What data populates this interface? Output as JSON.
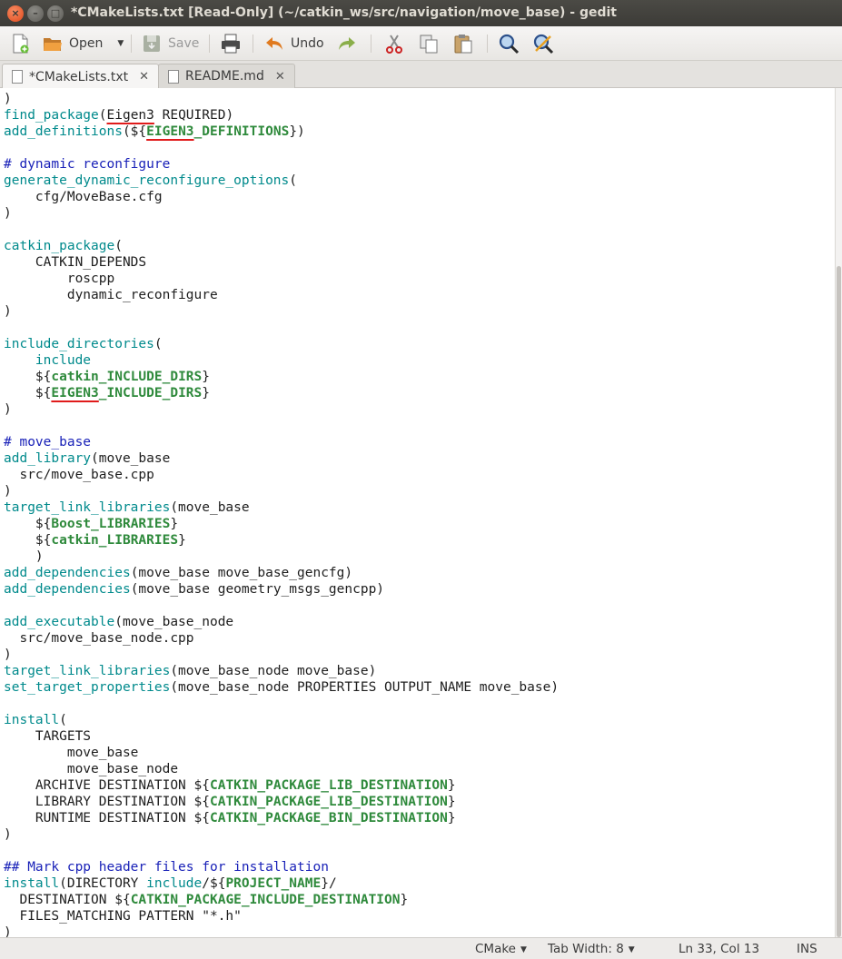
{
  "window": {
    "title": "*CMakeLists.txt [Read-Only] (~/catkin_ws/src/navigation/move_base) - gedit"
  },
  "toolbar": {
    "open_label": "Open",
    "save_label": "Save",
    "undo_label": "Undo"
  },
  "tabs": [
    {
      "label": "*CMakeLists.txt",
      "active": true
    },
    {
      "label": "README.md",
      "active": false
    }
  ],
  "editor": {
    "lines": [
      ")",
      "find_package(Eigen3 REQUIRED)",
      "add_definitions(${EIGEN3_DEFINITIONS})",
      "",
      "# dynamic reconfigure",
      "generate_dynamic_reconfigure_options(",
      "    cfg/MoveBase.cfg",
      ")",
      "",
      "catkin_package(",
      "    CATKIN_DEPENDS",
      "        roscpp",
      "        dynamic_reconfigure",
      ")",
      "",
      "include_directories(",
      "    include",
      "    ${catkin_INCLUDE_DIRS}",
      "    ${EIGEN3_INCLUDE_DIRS}",
      ")",
      "",
      "# move_base",
      "add_library(move_base",
      "  src/move_base.cpp",
      ")",
      "target_link_libraries(move_base",
      "    ${Boost_LIBRARIES}",
      "    ${catkin_LIBRARIES}",
      "    )",
      "add_dependencies(move_base move_base_gencfg)",
      "add_dependencies(move_base geometry_msgs_gencpp)",
      "",
      "add_executable(move_base_node",
      "  src/move_base_node.cpp",
      ")",
      "target_link_libraries(move_base_node move_base)",
      "set_target_properties(move_base_node PROPERTIES OUTPUT_NAME move_base)",
      "",
      "install(",
      "    TARGETS",
      "        move_base",
      "        move_base_node",
      "    ARCHIVE DESTINATION ${CATKIN_PACKAGE_LIB_DESTINATION}",
      "    LIBRARY DESTINATION ${CATKIN_PACKAGE_LIB_DESTINATION}",
      "    RUNTIME DESTINATION ${CATKIN_PACKAGE_BIN_DESTINATION}",
      ")",
      "",
      "## Mark cpp header files for installation",
      "install(DIRECTORY include/${PROJECT_NAME}/",
      "  DESTINATION ${CATKIN_PACKAGE_INCLUDE_DESTINATION}",
      "  FILES_MATCHING PATTERN \"*.h\"",
      ")"
    ],
    "keywords": [
      "find_package",
      "add_definitions",
      "generate_dynamic_reconfigure_options",
      "catkin_package",
      "include_directories",
      "add_library",
      "target_link_libraries",
      "add_dependencies",
      "add_executable",
      "set_target_properties",
      "install",
      "include"
    ],
    "underlined": [
      "Eigen3",
      "EIGEN3"
    ],
    "colors": {
      "keyword": "#008a8c",
      "comment": "#1a22b8",
      "variable": "#2f8a3c",
      "underline": "#e01b1b"
    }
  },
  "statusbar": {
    "language": "CMake",
    "tab_width": "Tab Width: 8",
    "position": "Ln 33, Col 13",
    "mode": "INS"
  },
  "icons": [
    "new-document-icon",
    "open-folder-icon",
    "save-icon",
    "print-icon",
    "undo-icon",
    "redo-icon",
    "cut-icon",
    "copy-icon",
    "paste-icon",
    "find-icon",
    "find-replace-icon"
  ]
}
